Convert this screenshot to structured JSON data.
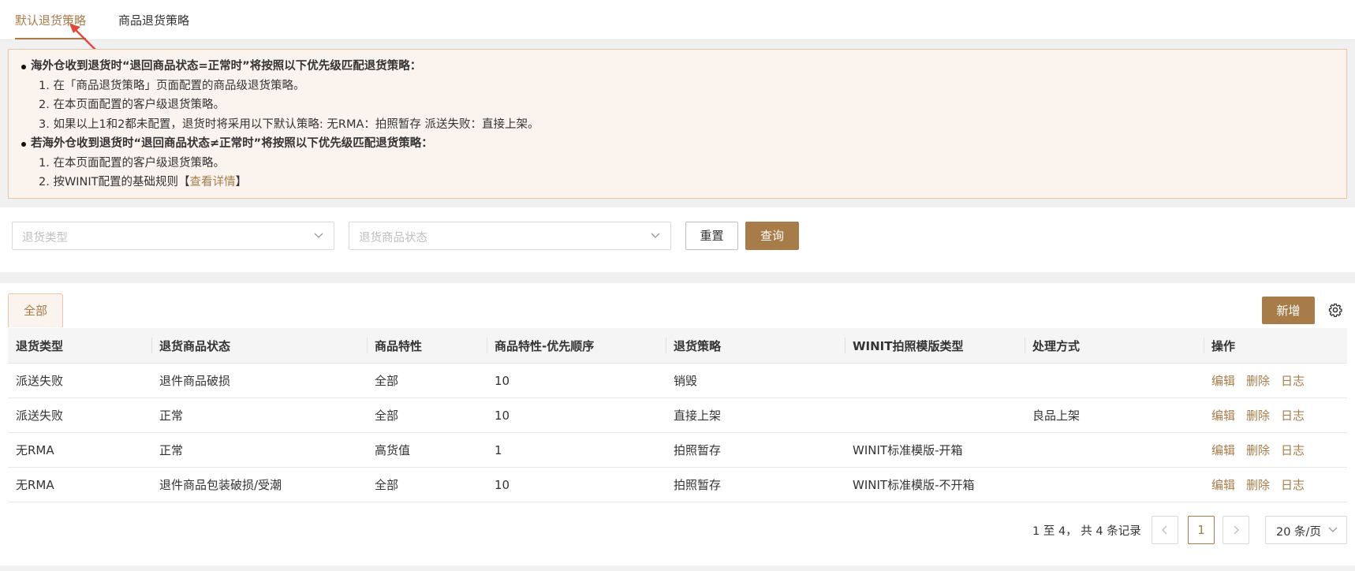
{
  "tabs": [
    {
      "label": "默认退货策略",
      "active": true
    },
    {
      "label": "商品退货策略",
      "active": false
    }
  ],
  "notice": {
    "section1_title": "海外仓收到退货时“退回商品状态=正常时”将按照以下优先级匹配退货策略：",
    "section1_items": [
      "1. 在「商品退货策略」页面配置的商品级退货策略。",
      "2. 在本页面配置的客户级退货策略。",
      "3. 如果以上1和2都未配置，退货时将采用以下默认策略: 无RMA：拍照暂存 派送失败：直接上架。"
    ],
    "section2_title": "若海外仓收到退货时“退回商品状态≠正常时”将按照以下优先级匹配退货策略：",
    "section2_items": [
      "1. 在本页面配置的客户级退货策略。"
    ],
    "section2_last_prefix": "2. 按WINIT配置的基础规则【",
    "section2_last_link": "查看详情",
    "section2_last_suffix": "】"
  },
  "filters": {
    "return_type_placeholder": "退货类型",
    "return_status_placeholder": "退货商品状态",
    "reset_label": "重置",
    "query_label": "查询"
  },
  "list": {
    "tab_all": "全部",
    "add_label": "新增",
    "columns": [
      "退货类型",
      "退货商品状态",
      "商品特性",
      "商品特性-优先顺序",
      "退货策略",
      "WINIT拍照模版类型",
      "处理方式",
      "操作"
    ],
    "rows": [
      [
        "派送失败",
        "退件商品破损",
        "全部",
        "10",
        "销毁",
        "",
        ""
      ],
      [
        "派送失败",
        "正常",
        "全部",
        "10",
        "直接上架",
        "",
        "良品上架"
      ],
      [
        "无RMA",
        "正常",
        "高货值",
        "1",
        "拍照暂存",
        "WINIT标准模版-开箱",
        ""
      ],
      [
        "无RMA",
        "退件商品包装破损/受潮",
        "全部",
        "10",
        "拍照暂存",
        "WINIT标准模版-不开箱",
        ""
      ]
    ],
    "actions": {
      "edit": "编辑",
      "delete": "删除",
      "log": "日志"
    }
  },
  "pagination": {
    "summary": "1 至 4， 共 4 条记录",
    "current_page": "1",
    "page_size": "20 条/页"
  },
  "colors": {
    "accent": "#a77c49",
    "notice_bg": "#faf3ee",
    "arrow": "#e04a3a"
  }
}
